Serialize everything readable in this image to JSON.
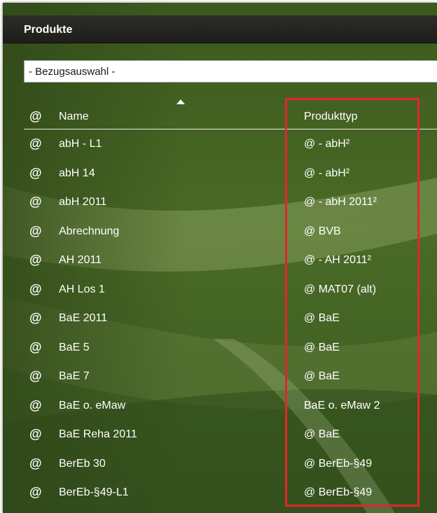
{
  "panel": {
    "title": "Produkte",
    "select_value": "- Bezugsauswahl -"
  },
  "table": {
    "header": {
      "icon": "@",
      "name": "Name",
      "type": "Produkttyp"
    },
    "rows": [
      {
        "icon": "@",
        "name": "abH - L1",
        "type": "@ - abH²"
      },
      {
        "icon": "@",
        "name": "abH 14",
        "type": "@ - abH²"
      },
      {
        "icon": "@",
        "name": "abH 2011",
        "type": "@ - abH 2011²"
      },
      {
        "icon": "@",
        "name": "Abrechnung",
        "type": "@ BVB"
      },
      {
        "icon": "@",
        "name": "AH 2011",
        "type": "@ - AH 2011²"
      },
      {
        "icon": "@",
        "name": "AH Los 1",
        "type": "@ MAT07 (alt)"
      },
      {
        "icon": "@",
        "name": "BaE 2011",
        "type": "@ BaE"
      },
      {
        "icon": "@",
        "name": "BaE 5",
        "type": "@ BaE"
      },
      {
        "icon": "@",
        "name": "BaE 7",
        "type": "@ BaE"
      },
      {
        "icon": "@",
        "name": "BaE o. eMaw",
        "type": "BaE o. eMaw 2"
      },
      {
        "icon": "@",
        "name": "BaE Reha 2011",
        "type": "@ BaE"
      },
      {
        "icon": "@",
        "name": "BerEb 30",
        "type": "@ BerEb-§49"
      },
      {
        "icon": "@",
        "name": "BerEb-§49-L1",
        "type": "@ BerEb-§49"
      }
    ]
  },
  "icons": {
    "sort": "sort-ascending-icon",
    "row": "at-sign-icon"
  },
  "colors": {
    "title_bar": "#1d1e1b",
    "highlight": "#e3262a",
    "background": "#3f5a22"
  }
}
